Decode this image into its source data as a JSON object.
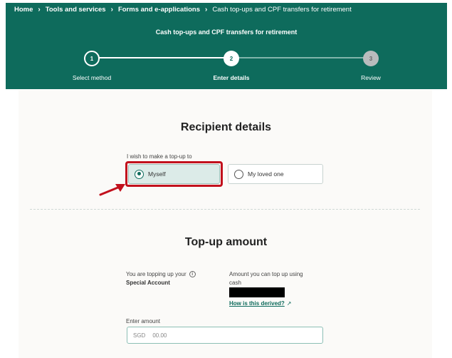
{
  "breadcrumbs": [
    "Home",
    "Tools and services",
    "Forms and e-applications",
    "Cash top-ups and CPF transfers for retirement"
  ],
  "flow_title": "Cash top-ups and CPF transfers for retirement",
  "steps": [
    {
      "number": "1",
      "label": "Select method",
      "state": "completed"
    },
    {
      "number": "2",
      "label": "Enter details",
      "state": "current"
    },
    {
      "number": "3",
      "label": "Review",
      "state": "upcoming"
    }
  ],
  "recipient": {
    "heading": "Recipient details",
    "question": "I wish to make a top-up to",
    "options": [
      {
        "label": "Myself",
        "selected": true
      },
      {
        "label": "My loved one",
        "selected": false
      }
    ]
  },
  "topup": {
    "heading": "Top-up amount",
    "account_label": "You are topping up your",
    "account_name": "Special Account",
    "limit_label_line1": "Amount you can top up using",
    "limit_label_line2": "cash",
    "derived_link": "How is this derived?",
    "enter_amount_label": "Enter amount",
    "currency": "SGD",
    "amount_placeholder": "00.00"
  },
  "colors": {
    "brand_green": "#0e6b5c",
    "highlight_red": "#c2111d"
  },
  "icons": [
    "chevron-right-icon",
    "info-icon",
    "external-link-icon",
    "arrow-annotation-icon"
  ]
}
